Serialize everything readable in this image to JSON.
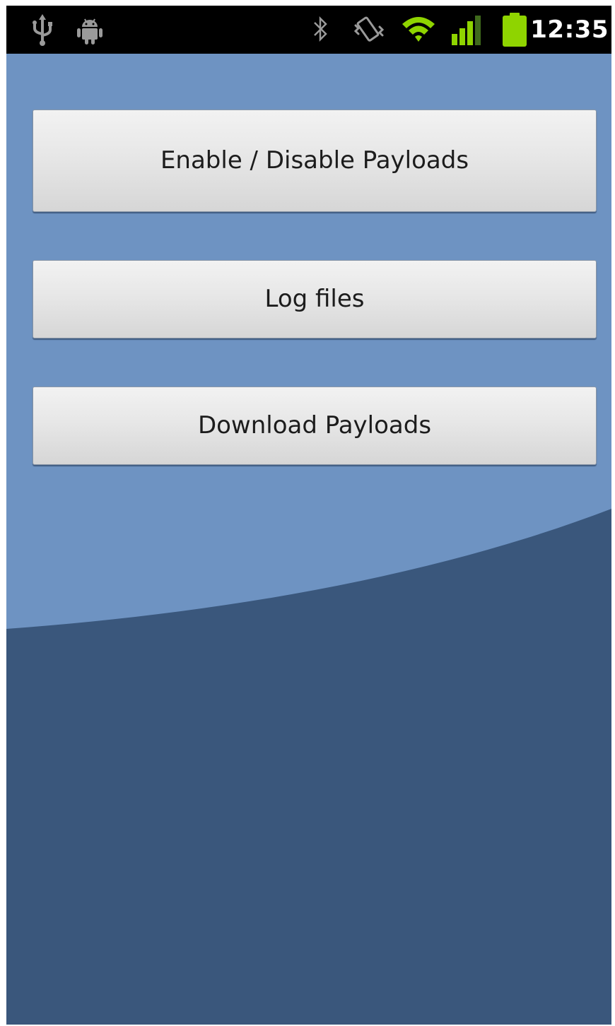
{
  "status_bar": {
    "time": "12:35",
    "icons": [
      "usb-icon",
      "android-debug-icon",
      "bluetooth-icon",
      "vibrate-icon",
      "wifi-icon",
      "signal-icon",
      "battery-icon"
    ],
    "colors": {
      "background": "#000000",
      "active_green": "#8fd400",
      "inactive_gray": "#9a9a9a"
    }
  },
  "main": {
    "buttons": [
      {
        "label": "Enable / Disable Payloads"
      },
      {
        "label": "Log files"
      },
      {
        "label": "Download Payloads"
      }
    ]
  },
  "theme": {
    "background_light": "#6e93c2",
    "background_dark": "#3a577c",
    "button_text": "#1c1c1c"
  }
}
